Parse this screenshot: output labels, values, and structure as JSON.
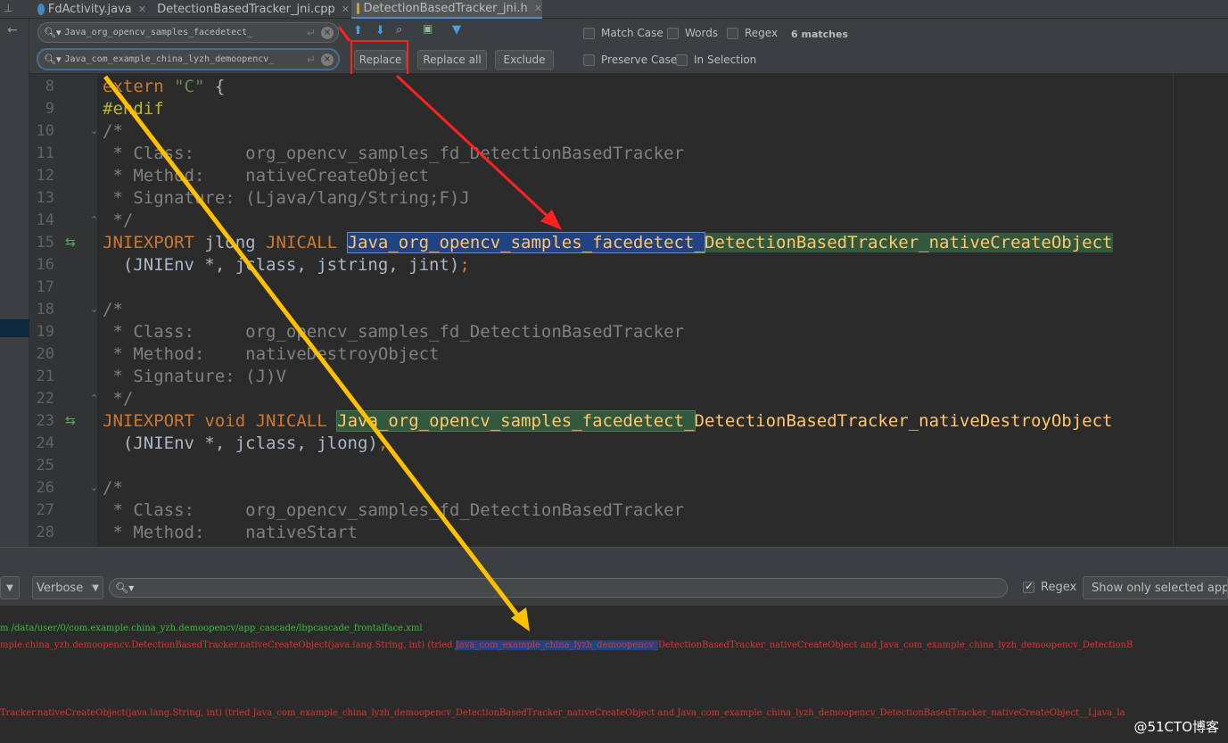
{
  "tabs": [
    {
      "label": "FdActivity.java",
      "icon": "class-icon",
      "active": false
    },
    {
      "label": "DetectionBasedTracker_jni.cpp",
      "icon": "cpp-file-icon",
      "active": false
    },
    {
      "label": "DetectionBasedTracker_jni.h",
      "icon": "header-file-icon",
      "active": true
    }
  ],
  "find": {
    "search_value": "Java_org_opencv_samples_facedetect_",
    "replace_value": "Java_com_example_china_lyzh_demoopencv_",
    "replace_label": "Replace",
    "replace_all_label": "Replace all",
    "exclude_label": "Exclude",
    "match_case_label": "Match Case",
    "words_label": "Words",
    "regex_label": "Regex",
    "matches_label": "6 matches",
    "preserve_case_label": "Preserve Case",
    "in_selection_label": "In Selection"
  },
  "editor": {
    "line_numbers": [
      "8",
      "9",
      "10",
      "11",
      "12",
      "13",
      "14",
      "15",
      "16",
      "17",
      "18",
      "19",
      "20",
      "21",
      "22",
      "23",
      "24",
      "25",
      "26",
      "27",
      "28"
    ],
    "l8_kw": "extern",
    "l8_str": "\"C\"",
    "l8_rest": " {",
    "l9": "#endif",
    "l10": "/*",
    "l11": " * Class:     org_opencv_samples_fd_DetectionBasedTracker",
    "l12": " * Method:    nativeCreateObject",
    "l13": " * Signature: (Ljava/lang/String;F)J",
    "l14": " */",
    "l15_a": "JNIEXPORT",
    "l15_b": " jlong ",
    "l15_c": "JNICALL",
    "l15_d": " ",
    "l15_match": "Java_org_opencv_samples_facedetect_",
    "l15_rest": "DetectionBasedTracker_nativeCreateObject",
    "l16_a": "  (JNIEnv *, jclass, jstring, jint)",
    "l16_b": ";",
    "l18": "/*",
    "l19": " * Class:     org_opencv_samples_fd_DetectionBasedTracker",
    "l20": " * Method:    nativeDestroyObject",
    "l21": " * Signature: (J)V",
    "l22": " */",
    "l23_a": "JNIEXPORT",
    "l23_b": " void ",
    "l23_c": "JNICALL",
    "l23_d": " ",
    "l23_match": "Java_org_opencv_samples_facedetect_",
    "l23_rest": "DetectionBasedTracker_nativeDestroyObject",
    "l24_a": "  (JNIEnv *, jclass, jlong)",
    "l24_b": ";",
    "l26": "/*",
    "l27": " * Class:     org_opencv_samples_fd_DetectionBasedTracker",
    "l28": " * Method:    nativeStart"
  },
  "logcat": {
    "level_value": "Verbose",
    "regex_label": "Regex",
    "filter_value": "Show only selected applica",
    "log1": "m /data/user/0/com.example.china_yzh.demoopencv/app_cascade/lbpcascade_frontalface.xml",
    "log2_a": "mple.china_yzh.demoopencv.DetectionBasedTracker.nativeCreateObject(java.lang.String, int) (tried ",
    "log2_sel": "Java_com_example_china_lyzh_demoopencv_",
    "log2_b": "DetectionBasedTracker_nativeCreateObject and Java_com_example_china_lyzh_demoopencv_DetectionB",
    "log3": "Tracker.nativeCreateObject(java.lang.String, int) (tried Java_com_example_china_lyzh_demoopencv_DetectionBasedTracker_nativeCreateObject and Java_com_example_china_lyzh_demoopencv_DetectionBasedTracker_nativeCreateObject__Ljava_la"
  },
  "watermark": "@51CTO博客",
  "colors": {
    "red_annotation": "#ff2020",
    "yellow_annotation": "#ffc000",
    "match_highlight": "#214283",
    "match_green": "#32593d"
  }
}
